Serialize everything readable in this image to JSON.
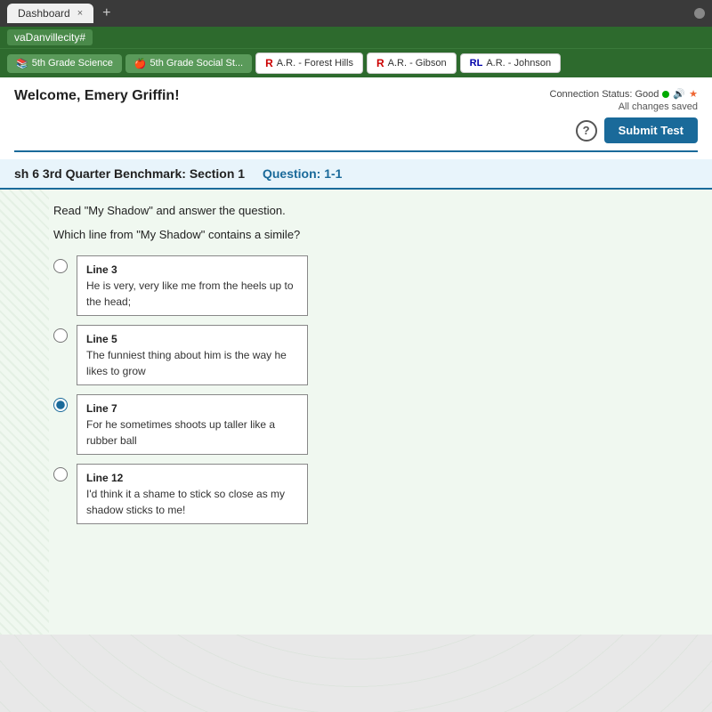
{
  "browser": {
    "tab_label": "Dashboard",
    "tab_close": "×",
    "tab_new": "+",
    "address": "vaDanvillecity#"
  },
  "nav_tabs": [
    {
      "id": "science",
      "icon": "📚",
      "icon_type": "book",
      "label": "5th Grade Science"
    },
    {
      "id": "social",
      "icon": "🍎",
      "icon_type": "apple",
      "label": "5th Grade Social St..."
    },
    {
      "id": "ar1",
      "icon": "R",
      "icon_type": "r",
      "label": "A.R. - Forest Hills"
    },
    {
      "id": "ar2",
      "icon": "R",
      "icon_type": "r",
      "label": "A.R. - Gibson"
    },
    {
      "id": "ar3",
      "icon": "RL",
      "icon_type": "rl",
      "label": "A.R. - Johnson"
    }
  ],
  "header": {
    "welcome": "Welcome, Emery Griffin!",
    "connection_label": "Connection Status: Good",
    "saved_label": "All changes saved",
    "help_label": "?",
    "submit_label": "Submit Test"
  },
  "section": {
    "title": "sh 6 3rd Quarter Benchmark: Section 1",
    "question_label": "Question: 1-1"
  },
  "question": {
    "instruction": "Read \"My Shadow\" and answer the question.",
    "text": "Which line from \"My Shadow\" contains a simile?",
    "options": [
      {
        "id": "opt1",
        "line": "Line 3",
        "text": "He is very, very like me from the heels up to the head;",
        "selected": false
      },
      {
        "id": "opt2",
        "line": "Line 5",
        "text": "The funniest thing about him is the way he likes to grow",
        "selected": false
      },
      {
        "id": "opt3",
        "line": "Line 7",
        "text": "For he sometimes shoots up taller like a rubber ball",
        "selected": true
      },
      {
        "id": "opt4",
        "line": "Line 12",
        "text": "I'd think it a shame to stick so close as my shadow sticks to me!",
        "selected": false
      }
    ]
  }
}
